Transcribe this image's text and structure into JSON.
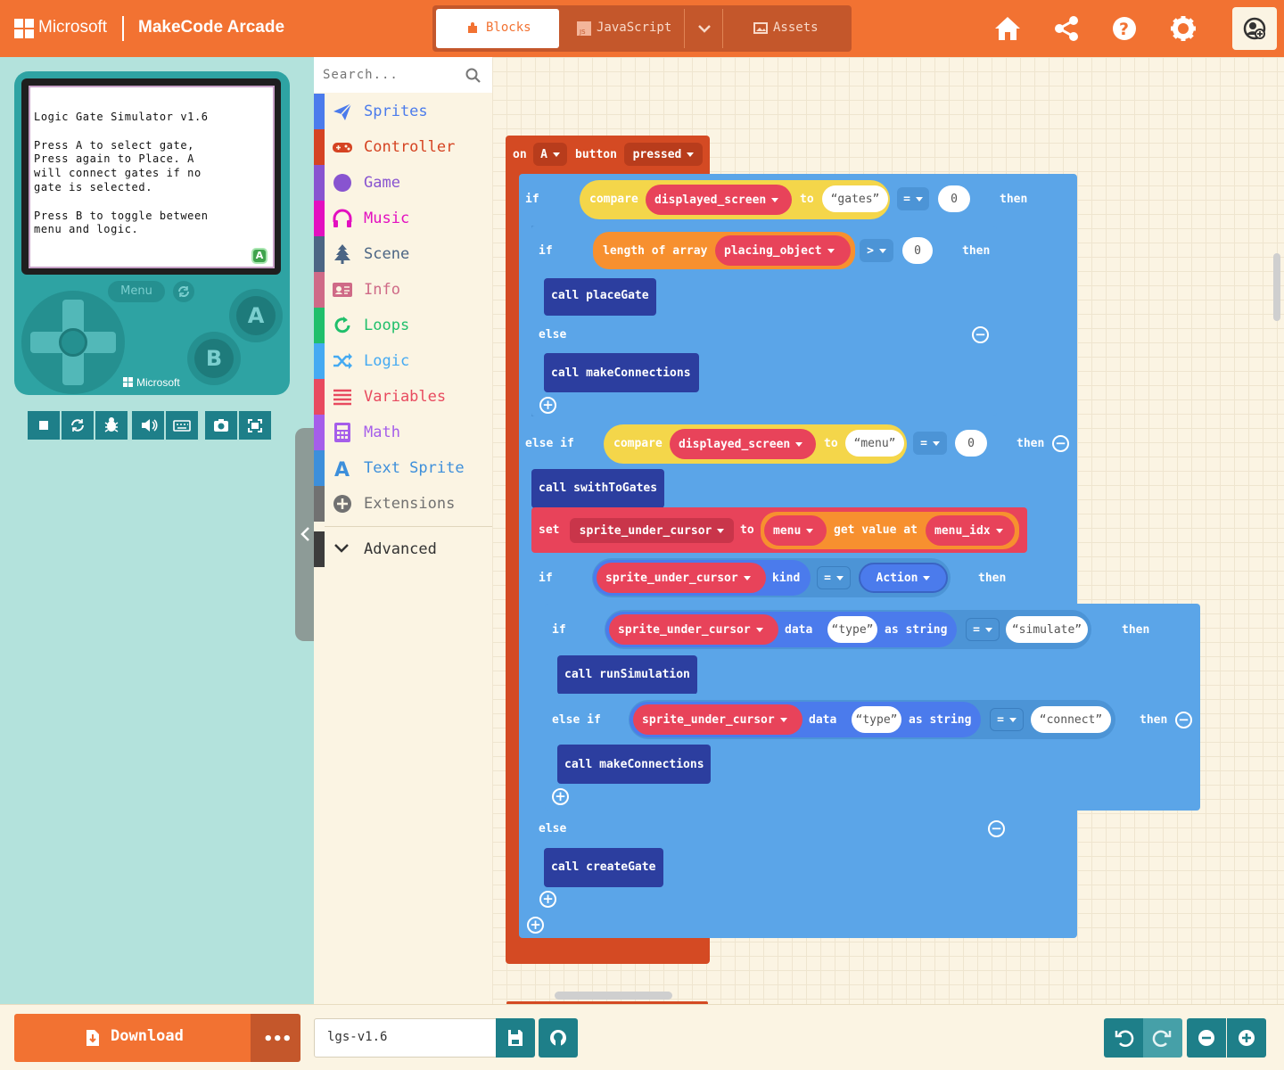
{
  "header": {
    "brand": "Microsoft",
    "product": "MakeCode Arcade",
    "tabs": [
      {
        "label": "Blocks",
        "active": true
      },
      {
        "label": "JavaScript",
        "active": false
      },
      {
        "label": "Assets",
        "active": false
      }
    ],
    "icons": [
      "home-icon",
      "share-icon",
      "help-icon",
      "settings-icon",
      "account-icon"
    ]
  },
  "simulator": {
    "screen_lines": [
      "Logic Gate Simulator v1.6",
      "",
      "Press A to select gate,",
      "Press again to Place. A",
      "will connect gates if no",
      "gate is selected.",
      "",
      "Press B to toggle between",
      "menu and logic."
    ],
    "badge": "A",
    "menu_label": "Menu",
    "button_a": "A",
    "button_b": "B",
    "brand": "Microsoft",
    "toolbar": [
      "stop-icon",
      "restart-icon",
      "debug-icon",
      "sound-icon",
      "keyboard-icon",
      "screenshot-icon",
      "fullscreen-icon"
    ]
  },
  "toolbox": {
    "search_placeholder": "Search...",
    "categories": [
      {
        "label": "Sprites",
        "color": "#4b7bec",
        "icon": "paper-plane-icon"
      },
      {
        "label": "Controller",
        "color": "#d54322",
        "icon": "gamepad-icon"
      },
      {
        "label": "Game",
        "color": "#8854d0",
        "icon": "circle-icon"
      },
      {
        "label": "Music",
        "color": "#e30fc0",
        "icon": "headphones-icon"
      },
      {
        "label": "Scene",
        "color": "#4b6584",
        "icon": "tree-icon"
      },
      {
        "label": "Info",
        "color": "#cf6a87",
        "icon": "id-card-icon"
      },
      {
        "label": "Loops",
        "color": "#20bf6b",
        "icon": "loop-icon"
      },
      {
        "label": "Logic",
        "color": "#45aaf2",
        "icon": "shuffle-icon"
      },
      {
        "label": "Variables",
        "color": "#e84a5f",
        "icon": "list-icon"
      },
      {
        "label": "Math",
        "color": "#a55eea",
        "icon": "calculator-icon"
      },
      {
        "label": "Text Sprite",
        "color": "#3d8fdb",
        "icon": "letter-a-icon"
      },
      {
        "label": "Extensions",
        "color": "#717171",
        "icon": "plus-circle-icon"
      }
    ],
    "advanced_label": "Advanced"
  },
  "workspace": {
    "event": {
      "on": "on",
      "button": "A",
      "label": "button",
      "event": "pressed"
    },
    "kw": {
      "if": "if",
      "then": "then",
      "else": "else",
      "else_if": "else if",
      "call": "call",
      "set": "set",
      "to": "to",
      "compare": "compare",
      "length_of_array": "length of array",
      "get_value_at": "get value at",
      "kind": "kind",
      "data": "data",
      "as_string": "as string"
    },
    "vars": {
      "displayed_screen": "displayed_screen",
      "placing_object": "placing_object",
      "sprite_under_cursor": "sprite_under_cursor",
      "menu": "menu",
      "menu_idx": "menu_idx"
    },
    "strings": {
      "gates": "gates",
      "menu": "menu",
      "type": "type",
      "simulate": "simulate",
      "connect": "connect"
    },
    "ops": {
      "eq": "=",
      "gt": ">"
    },
    "numbers": {
      "zero": "0"
    },
    "enum_action": "Action",
    "functions": {
      "placeGate": "placeGate",
      "makeConnections": "makeConnections",
      "swithToGates": "swithToGates",
      "runSimulation": "runSimulation",
      "createGate": "createGate"
    }
  },
  "footer": {
    "download_label": "Download",
    "more_label": "•••",
    "project_name": "lgs-v1.6",
    "icons": [
      "save-icon",
      "github-icon",
      "undo-icon",
      "redo-icon",
      "zoom-out-icon",
      "zoom-in-icon"
    ]
  },
  "colors": {
    "header": "#f27232",
    "sim_bg": "#b3e2dc",
    "event_block": "#d44a23",
    "logic_block": "#5ba5e8",
    "function_block": "#2c3e9f",
    "variable_block": "#e8435a",
    "compare_block": "#f4d64a",
    "array_block": "#f7902f"
  }
}
